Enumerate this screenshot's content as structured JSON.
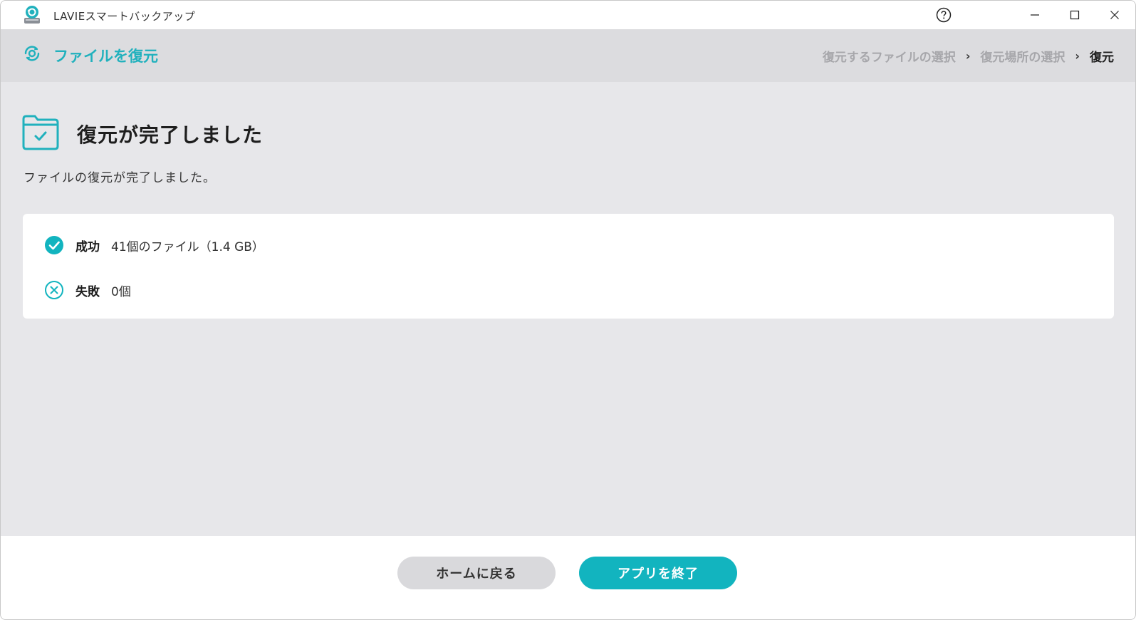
{
  "window": {
    "title": "LAVIEスマートバックアップ",
    "controls": {
      "help": "help-icon",
      "minimize": "minimize-icon",
      "maximize": "maximize-icon",
      "close": "close-icon"
    }
  },
  "header": {
    "title": "ファイルを復元",
    "breadcrumb": [
      {
        "label": "復元するファイルの選択",
        "active": false
      },
      {
        "label": "復元場所の選択",
        "active": false
      },
      {
        "label": "復元",
        "active": true
      }
    ],
    "separator": "›"
  },
  "result": {
    "title": "復元が完了しました",
    "description": "ファイルの復元が完了しました。"
  },
  "summary": {
    "success": {
      "label": "成功",
      "value": "41個のファイル（1.4 GB）"
    },
    "failure": {
      "label": "失敗",
      "value": "0個"
    }
  },
  "footer": {
    "home_button": "ホームに戻る",
    "exit_button": "アプリを終了"
  },
  "colors": {
    "accent": "#12b4bf",
    "header_bg": "#dcdcdf",
    "content_bg": "#e7e7ea"
  }
}
